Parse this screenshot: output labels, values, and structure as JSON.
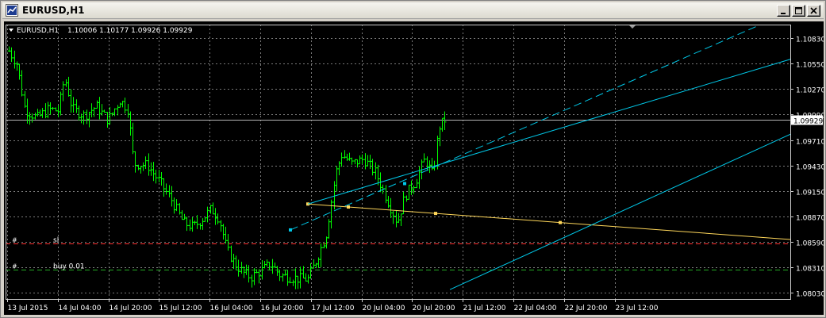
{
  "window": {
    "title": "EURUSD,H1",
    "buttons": {
      "minimize": "minimize-icon",
      "restore": "restore-icon",
      "close": "close-icon"
    }
  },
  "chart_data": {
    "type": "bar",
    "symbol_label": "EURUSD,H1",
    "ohlc_label": "1.10006 1.10177 1.09926 1.09929",
    "colors": {
      "background": "#000000",
      "bars": "#00ff00",
      "grid": "#7a7a7a",
      "channel": "#00c8e8",
      "trendline": "#ffd75a",
      "sl_line": "#ff3030",
      "buy_line": "#22aa22",
      "bid_line": "#b4b4b4",
      "text": "#ffffff"
    },
    "y_ticks": [
      "1.10830",
      "1.10550",
      "1.10270",
      "1.09990",
      "1.09710",
      "1.09430",
      "1.09150",
      "1.08870",
      "1.08590",
      "1.08310",
      "1.08030"
    ],
    "ylim": [
      1.0796,
      1.1098
    ],
    "x_ticks": [
      "13 Jul 2015",
      "14 Jul 04:00",
      "14 Jul 20:00",
      "15 Jul 12:00",
      "16 Jul 04:00",
      "16 Jul 20:00",
      "17 Jul 12:00",
      "20 Jul 04:00",
      "20 Jul 20:00",
      "21 Jul 12:00",
      "22 Jul 04:00",
      "22 Jul 20:00",
      "23 Jul 12:00"
    ],
    "current_price": "1.09929",
    "current_price_value": 1.09929,
    "sl_label": "sl",
    "sl_price": 1.0857,
    "buy_label": "buy 0.01",
    "buy_price": 1.08285,
    "trendline": {
      "from": 1.09005,
      "to": 1.08615
    },
    "channel": {
      "lower_start": 1.08063,
      "lower_end": 1.09773,
      "upper_start": 1.09005,
      "upper_end": 1.10598,
      "mid_start": 1.0872,
      "mid_end": 1.1097
    },
    "bars_count": 170,
    "anchors": [
      [
        0,
        1.1069
      ],
      [
        4,
        1.1055
      ],
      [
        8,
        1.1005
      ],
      [
        14,
        1.0995
      ],
      [
        20,
        1.1005
      ],
      [
        25,
        1.1003
      ],
      [
        28,
        1.104
      ],
      [
        32,
        1.1005
      ],
      [
        38,
        1.0998
      ],
      [
        44,
        1.1008
      ],
      [
        50,
        1.0993
      ],
      [
        56,
        1.1015
      ],
      [
        60,
        1.1005
      ],
      [
        63,
        1.0945
      ],
      [
        70,
        1.0943
      ],
      [
        76,
        1.0925
      ],
      [
        82,
        1.0905
      ],
      [
        88,
        1.088
      ],
      [
        93,
        1.0875
      ],
      [
        98,
        1.0885
      ],
      [
        102,
        1.0895
      ],
      [
        106,
        1.0885
      ],
      [
        110,
        1.085
      ],
      [
        114,
        1.0835
      ],
      [
        118,
        1.0825
      ],
      [
        122,
        1.082
      ],
      [
        128,
        1.0828
      ],
      [
        132,
        1.0835
      ],
      [
        137,
        1.0822
      ],
      [
        142,
        1.082
      ],
      [
        147,
        1.0818
      ],
      [
        151,
        1.0818
      ],
      [
        155,
        1.0838
      ],
      [
        160,
        1.0866
      ],
      [
        165,
        1.0935
      ],
      [
        168,
        1.0955
      ],
      [
        173,
        1.0945
      ],
      [
        179,
        1.095
      ],
      [
        185,
        1.0935
      ],
      [
        189,
        1.0915
      ],
      [
        193,
        1.0895
      ],
      [
        196,
        1.088
      ],
      [
        200,
        1.091
      ],
      [
        205,
        1.0925
      ],
      [
        210,
        1.095
      ],
      [
        214,
        1.0932
      ],
      [
        217,
        1.0985
      ],
      [
        220,
        1.0993
      ]
    ]
  }
}
